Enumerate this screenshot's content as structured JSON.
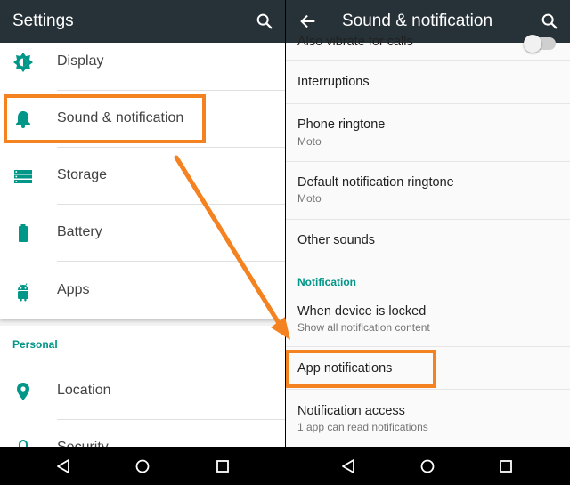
{
  "colors": {
    "toolbar": "#263238",
    "accent": "#009688",
    "highlight": "#f58220"
  },
  "left": {
    "title": "Settings",
    "items": [
      {
        "label": "Display",
        "icon": "brightness-icon"
      },
      {
        "label": "Sound & notification",
        "icon": "bell-icon"
      },
      {
        "label": "Storage",
        "icon": "storage-icon"
      },
      {
        "label": "Battery",
        "icon": "battery-icon"
      },
      {
        "label": "Apps",
        "icon": "android-icon"
      }
    ],
    "section": "Personal",
    "personal_items": [
      {
        "label": "Location",
        "icon": "location-icon"
      },
      {
        "label": "Security",
        "icon": "lock-icon"
      }
    ]
  },
  "right": {
    "title": "Sound & notification",
    "partial_item": "Also vibrate for calls",
    "items": [
      {
        "main": "Interruptions",
        "sub": ""
      },
      {
        "main": "Phone ringtone",
        "sub": "Moto"
      },
      {
        "main": "Default notification ringtone",
        "sub": "Moto"
      },
      {
        "main": "Other sounds",
        "sub": ""
      }
    ],
    "section": "Notification",
    "notif_items": [
      {
        "main": "When device is locked",
        "sub": "Show all notification content"
      },
      {
        "main": "App notifications",
        "sub": ""
      },
      {
        "main": "Notification access",
        "sub": "1 app can read notifications"
      }
    ]
  }
}
